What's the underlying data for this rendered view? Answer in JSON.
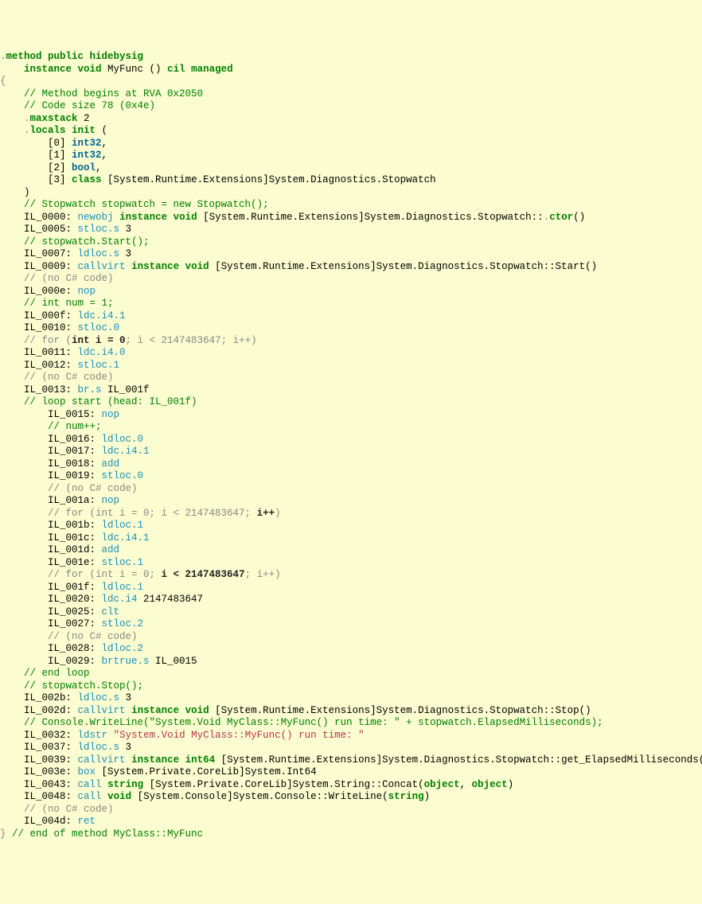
{
  "lines": [
    {
      "indent": 0,
      "tokens": [
        {
          "cls": "punct",
          "t": "."
        },
        {
          "cls": "kw",
          "t": "method public hidebysig"
        }
      ]
    },
    {
      "indent": 1,
      "tokens": [
        {
          "cls": "kw",
          "t": "instance void"
        },
        {
          "cls": "",
          "t": " MyFunc () "
        },
        {
          "cls": "kw",
          "t": "cil managed"
        }
      ]
    },
    {
      "indent": 0,
      "tokens": [
        {
          "cls": "punct",
          "t": "{"
        }
      ]
    },
    {
      "indent": 1,
      "tokens": [
        {
          "cls": "comment",
          "t": "// Method begins at RVA 0x2050"
        }
      ]
    },
    {
      "indent": 1,
      "tokens": [
        {
          "cls": "comment",
          "t": "// Code size 78 (0x4e)"
        }
      ]
    },
    {
      "indent": 1,
      "tokens": [
        {
          "cls": "punct",
          "t": "."
        },
        {
          "cls": "kw",
          "t": "maxstack"
        },
        {
          "cls": "",
          "t": " 2"
        }
      ]
    },
    {
      "indent": 1,
      "tokens": [
        {
          "cls": "punct",
          "t": "."
        },
        {
          "cls": "kw",
          "t": "locals init"
        },
        {
          "cls": "",
          "t": " ("
        }
      ]
    },
    {
      "indent": 2,
      "tokens": [
        {
          "cls": "",
          "t": "[0] "
        },
        {
          "cls": "type",
          "t": "int32"
        },
        {
          "cls": "",
          "t": ","
        }
      ]
    },
    {
      "indent": 2,
      "tokens": [
        {
          "cls": "",
          "t": "[1] "
        },
        {
          "cls": "type",
          "t": "int32"
        },
        {
          "cls": "",
          "t": ","
        }
      ]
    },
    {
      "indent": 2,
      "tokens": [
        {
          "cls": "",
          "t": "[2] "
        },
        {
          "cls": "type",
          "t": "bool"
        },
        {
          "cls": "",
          "t": ","
        }
      ]
    },
    {
      "indent": 2,
      "tokens": [
        {
          "cls": "",
          "t": "[3] "
        },
        {
          "cls": "kw",
          "t": "class"
        },
        {
          "cls": "",
          "t": " [System.Runtime.Extensions]System.Diagnostics.Stopwatch"
        }
      ]
    },
    {
      "indent": 1,
      "tokens": [
        {
          "cls": "",
          "t": ")"
        }
      ]
    },
    {
      "indent": 0,
      "tokens": [
        {
          "cls": "",
          "t": ""
        }
      ]
    },
    {
      "indent": 1,
      "tokens": [
        {
          "cls": "comment",
          "t": "// Stopwatch stopwatch = new Stopwatch();"
        }
      ]
    },
    {
      "indent": 1,
      "tokens": [
        {
          "cls": "",
          "t": "IL_0000: "
        },
        {
          "cls": "op",
          "t": "newobj"
        },
        {
          "cls": "",
          "t": " "
        },
        {
          "cls": "kw",
          "t": "instance void"
        },
        {
          "cls": "",
          "t": " [System.Runtime.Extensions]System.Diagnostics.Stopwatch::"
        },
        {
          "cls": "punct",
          "t": "."
        },
        {
          "cls": "kw",
          "t": "ctor"
        },
        {
          "cls": "",
          "t": "()"
        }
      ]
    },
    {
      "indent": 1,
      "tokens": [
        {
          "cls": "",
          "t": "IL_0005: "
        },
        {
          "cls": "op",
          "t": "stloc.s"
        },
        {
          "cls": "",
          "t": " 3"
        }
      ]
    },
    {
      "indent": 1,
      "tokens": [
        {
          "cls": "comment",
          "t": "// stopwatch.Start();"
        }
      ]
    },
    {
      "indent": 1,
      "tokens": [
        {
          "cls": "",
          "t": "IL_0007: "
        },
        {
          "cls": "op",
          "t": "ldloc.s"
        },
        {
          "cls": "",
          "t": " 3"
        }
      ]
    },
    {
      "indent": 1,
      "tokens": [
        {
          "cls": "",
          "t": "IL_0009: "
        },
        {
          "cls": "op",
          "t": "callvirt"
        },
        {
          "cls": "",
          "t": " "
        },
        {
          "cls": "kw",
          "t": "instance void"
        },
        {
          "cls": "",
          "t": " [System.Runtime.Extensions]System.Diagnostics.Stopwatch::Start()"
        }
      ]
    },
    {
      "indent": 1,
      "tokens": [
        {
          "cls": "comment-gray",
          "t": "// (no C# code)"
        }
      ]
    },
    {
      "indent": 1,
      "tokens": [
        {
          "cls": "",
          "t": "IL_000e: "
        },
        {
          "cls": "op",
          "t": "nop"
        }
      ]
    },
    {
      "indent": 1,
      "tokens": [
        {
          "cls": "comment",
          "t": "// int num = 1;"
        }
      ]
    },
    {
      "indent": 1,
      "tokens": [
        {
          "cls": "",
          "t": "IL_000f: "
        },
        {
          "cls": "op",
          "t": "ldc.i4.1"
        }
      ]
    },
    {
      "indent": 1,
      "tokens": [
        {
          "cls": "",
          "t": "IL_0010: "
        },
        {
          "cls": "op",
          "t": "stloc.0"
        }
      ]
    },
    {
      "indent": 1,
      "tokens": [
        {
          "cls": "comment-gray",
          "t": "// for ("
        },
        {
          "cls": "comment-gray-em",
          "t": "int i = 0"
        },
        {
          "cls": "comment-gray",
          "t": "; i < 2147483647; i++)"
        }
      ]
    },
    {
      "indent": 1,
      "tokens": [
        {
          "cls": "",
          "t": "IL_0011: "
        },
        {
          "cls": "op",
          "t": "ldc.i4.0"
        }
      ]
    },
    {
      "indent": 1,
      "tokens": [
        {
          "cls": "",
          "t": "IL_0012: "
        },
        {
          "cls": "op",
          "t": "stloc.1"
        }
      ]
    },
    {
      "indent": 1,
      "tokens": [
        {
          "cls": "comment-gray",
          "t": "// (no C# code)"
        }
      ]
    },
    {
      "indent": 1,
      "tokens": [
        {
          "cls": "",
          "t": "IL_0013: "
        },
        {
          "cls": "op",
          "t": "br.s"
        },
        {
          "cls": "",
          "t": " IL_001f"
        }
      ]
    },
    {
      "indent": 1,
      "tokens": [
        {
          "cls": "comment",
          "t": "// loop start (head: IL_001f)"
        }
      ]
    },
    {
      "indent": 2,
      "tokens": [
        {
          "cls": "",
          "t": "IL_0015: "
        },
        {
          "cls": "op",
          "t": "nop"
        }
      ]
    },
    {
      "indent": 2,
      "tokens": [
        {
          "cls": "comment",
          "t": "// num++;"
        }
      ]
    },
    {
      "indent": 2,
      "tokens": [
        {
          "cls": "",
          "t": "IL_0016: "
        },
        {
          "cls": "op",
          "t": "ldloc.0"
        }
      ]
    },
    {
      "indent": 2,
      "tokens": [
        {
          "cls": "",
          "t": "IL_0017: "
        },
        {
          "cls": "op",
          "t": "ldc.i4.1"
        }
      ]
    },
    {
      "indent": 2,
      "tokens": [
        {
          "cls": "",
          "t": "IL_0018: "
        },
        {
          "cls": "op",
          "t": "add"
        }
      ]
    },
    {
      "indent": 2,
      "tokens": [
        {
          "cls": "",
          "t": "IL_0019: "
        },
        {
          "cls": "op",
          "t": "stloc.0"
        }
      ]
    },
    {
      "indent": 2,
      "tokens": [
        {
          "cls": "comment-gray",
          "t": "// (no C# code)"
        }
      ]
    },
    {
      "indent": 2,
      "tokens": [
        {
          "cls": "",
          "t": "IL_001a: "
        },
        {
          "cls": "op",
          "t": "nop"
        }
      ]
    },
    {
      "indent": 2,
      "tokens": [
        {
          "cls": "comment-gray",
          "t": "// for (int i = 0; i < 2147483647; "
        },
        {
          "cls": "comment-gray-em",
          "t": "i++"
        },
        {
          "cls": "comment-gray",
          "t": ")"
        }
      ]
    },
    {
      "indent": 2,
      "tokens": [
        {
          "cls": "",
          "t": "IL_001b: "
        },
        {
          "cls": "op",
          "t": "ldloc.1"
        }
      ]
    },
    {
      "indent": 2,
      "tokens": [
        {
          "cls": "",
          "t": "IL_001c: "
        },
        {
          "cls": "op",
          "t": "ldc.i4.1"
        }
      ]
    },
    {
      "indent": 2,
      "tokens": [
        {
          "cls": "",
          "t": "IL_001d: "
        },
        {
          "cls": "op",
          "t": "add"
        }
      ]
    },
    {
      "indent": 2,
      "tokens": [
        {
          "cls": "",
          "t": "IL_001e: "
        },
        {
          "cls": "op",
          "t": "stloc.1"
        }
      ]
    },
    {
      "indent": 0,
      "tokens": [
        {
          "cls": "",
          "t": ""
        }
      ]
    },
    {
      "indent": 2,
      "tokens": [
        {
          "cls": "comment-gray",
          "t": "// for (int i = 0; "
        },
        {
          "cls": "comment-gray-em",
          "t": "i < 2147483647"
        },
        {
          "cls": "comment-gray",
          "t": "; i++)"
        }
      ]
    },
    {
      "indent": 2,
      "tokens": [
        {
          "cls": "",
          "t": "IL_001f: "
        },
        {
          "cls": "op",
          "t": "ldloc.1"
        }
      ]
    },
    {
      "indent": 2,
      "tokens": [
        {
          "cls": "",
          "t": "IL_0020: "
        },
        {
          "cls": "op",
          "t": "ldc.i4"
        },
        {
          "cls": "",
          "t": " 2147483647"
        }
      ]
    },
    {
      "indent": 2,
      "tokens": [
        {
          "cls": "",
          "t": "IL_0025: "
        },
        {
          "cls": "op",
          "t": "clt"
        }
      ]
    },
    {
      "indent": 2,
      "tokens": [
        {
          "cls": "",
          "t": "IL_0027: "
        },
        {
          "cls": "op",
          "t": "stloc.2"
        }
      ]
    },
    {
      "indent": 2,
      "tokens": [
        {
          "cls": "comment-gray",
          "t": "// (no C# code)"
        }
      ]
    },
    {
      "indent": 2,
      "tokens": [
        {
          "cls": "",
          "t": "IL_0028: "
        },
        {
          "cls": "op",
          "t": "ldloc.2"
        }
      ]
    },
    {
      "indent": 2,
      "tokens": [
        {
          "cls": "",
          "t": "IL_0029: "
        },
        {
          "cls": "op",
          "t": "brtrue.s"
        },
        {
          "cls": "",
          "t": " IL_0015"
        }
      ]
    },
    {
      "indent": 1,
      "tokens": [
        {
          "cls": "comment",
          "t": "// end loop"
        }
      ]
    },
    {
      "indent": 0,
      "tokens": [
        {
          "cls": "",
          "t": ""
        }
      ]
    },
    {
      "indent": 1,
      "tokens": [
        {
          "cls": "comment",
          "t": "// stopwatch.Stop();"
        }
      ]
    },
    {
      "indent": 1,
      "tokens": [
        {
          "cls": "",
          "t": "IL_002b: "
        },
        {
          "cls": "op",
          "t": "ldloc.s"
        },
        {
          "cls": "",
          "t": " 3"
        }
      ]
    },
    {
      "indent": 1,
      "tokens": [
        {
          "cls": "",
          "t": "IL_002d: "
        },
        {
          "cls": "op",
          "t": "callvirt"
        },
        {
          "cls": "",
          "t": " "
        },
        {
          "cls": "kw",
          "t": "instance void"
        },
        {
          "cls": "",
          "t": " [System.Runtime.Extensions]System.Diagnostics.Stopwatch::Stop()"
        }
      ]
    },
    {
      "indent": 1,
      "tokens": [
        {
          "cls": "comment",
          "t": "// Console.WriteLine(\"System.Void MyClass::MyFunc() run time: \" + stopwatch.ElapsedMilliseconds);"
        }
      ]
    },
    {
      "indent": 1,
      "tokens": [
        {
          "cls": "",
          "t": "IL_0032: "
        },
        {
          "cls": "op",
          "t": "ldstr"
        },
        {
          "cls": "",
          "t": " "
        },
        {
          "cls": "str",
          "t": "\"System.Void MyClass::MyFunc() run time: \""
        }
      ]
    },
    {
      "indent": 1,
      "tokens": [
        {
          "cls": "",
          "t": "IL_0037: "
        },
        {
          "cls": "op",
          "t": "ldloc.s"
        },
        {
          "cls": "",
          "t": " 3"
        }
      ]
    },
    {
      "indent": 1,
      "tokens": [
        {
          "cls": "",
          "t": "IL_0039: "
        },
        {
          "cls": "op",
          "t": "callvirt"
        },
        {
          "cls": "",
          "t": " "
        },
        {
          "cls": "kw",
          "t": "instance int64"
        },
        {
          "cls": "",
          "t": " [System.Runtime.Extensions]System.Diagnostics.Stopwatch::get_ElapsedMilliseconds()"
        }
      ]
    },
    {
      "indent": 1,
      "tokens": [
        {
          "cls": "",
          "t": "IL_003e: "
        },
        {
          "cls": "op",
          "t": "box"
        },
        {
          "cls": "",
          "t": " [System.Private.CoreLib]System.Int64"
        }
      ]
    },
    {
      "indent": 1,
      "tokens": [
        {
          "cls": "",
          "t": "IL_0043: "
        },
        {
          "cls": "op",
          "t": "call"
        },
        {
          "cls": "",
          "t": " "
        },
        {
          "cls": "kw",
          "t": "string"
        },
        {
          "cls": "",
          "t": " [System.Private.CoreLib]System.String::Concat("
        },
        {
          "cls": "kw",
          "t": "object"
        },
        {
          "cls": "",
          "t": ", "
        },
        {
          "cls": "kw",
          "t": "object"
        },
        {
          "cls": "",
          "t": ")"
        }
      ]
    },
    {
      "indent": 1,
      "tokens": [
        {
          "cls": "",
          "t": "IL_0048: "
        },
        {
          "cls": "op",
          "t": "call"
        },
        {
          "cls": "",
          "t": " "
        },
        {
          "cls": "kw",
          "t": "void"
        },
        {
          "cls": "",
          "t": " [System.Console]System.Console::WriteLine("
        },
        {
          "cls": "kw",
          "t": "string"
        },
        {
          "cls": "",
          "t": ")"
        }
      ]
    },
    {
      "indent": 1,
      "tokens": [
        {
          "cls": "comment-gray",
          "t": "// (no C# code)"
        }
      ]
    },
    {
      "indent": 1,
      "tokens": [
        {
          "cls": "",
          "t": "IL_004d: "
        },
        {
          "cls": "op",
          "t": "ret"
        }
      ]
    },
    {
      "indent": 0,
      "tokens": [
        {
          "cls": "punct",
          "t": "} "
        },
        {
          "cls": "comment",
          "t": "// end of method MyClass::MyFunc"
        }
      ]
    }
  ],
  "indentUnit": "    "
}
